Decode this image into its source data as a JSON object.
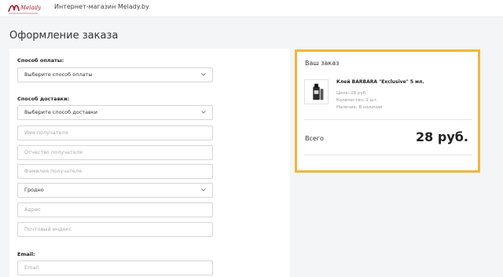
{
  "header": {
    "logo_text": "Melady",
    "site_title": "Интернет-магазин Melady.by"
  },
  "page": {
    "title": "Оформление заказа"
  },
  "form": {
    "payment_label": "Способ оплаты:",
    "payment_select": "Выберите способ оплаты",
    "delivery_label": "Способ доставки:",
    "delivery_select": "Выберите способ доставки",
    "recipient_name_placeholder": "Имя получателя",
    "patronymic_placeholder": "Отчество получателя",
    "surname_placeholder": "Фамилия получателя",
    "city_select": "Гродно",
    "address_placeholder": "Адрес",
    "postal_placeholder": "Почтовый индекс",
    "email_label": "Email:",
    "email_placeholder": "Email"
  },
  "order": {
    "title": "Ваш заказ",
    "product_name": "Клей BARBARA \"Exclusive\" 5 мл.",
    "price": "Цена: 28 руб.",
    "quantity": "Количество: 1 шт.",
    "availability": "Наличие: В наличии",
    "total_label": "Всего",
    "total_value": "28 руб."
  },
  "colors": {
    "accent_border": "#f2b63a",
    "logo_red": "#a3182c"
  }
}
